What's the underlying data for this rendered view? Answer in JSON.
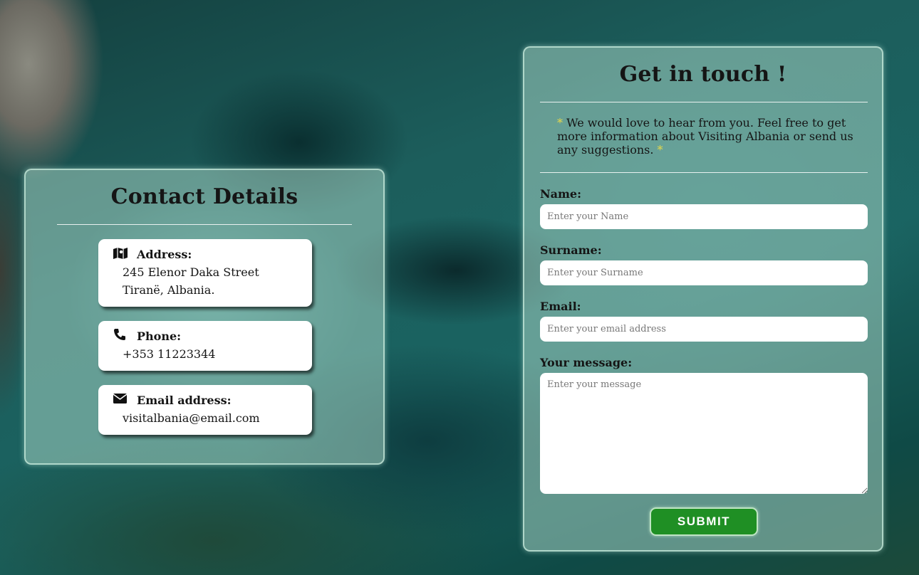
{
  "contact": {
    "title": "Contact Details",
    "cards": [
      {
        "icon": "map-icon",
        "label": "Address:",
        "lines": [
          "245 Elenor Daka Street",
          "Tiranë, Albania."
        ]
      },
      {
        "icon": "phone-icon",
        "label": "Phone:",
        "lines": [
          "+353 11223344"
        ]
      },
      {
        "icon": "envelope-icon",
        "label": "Email address:",
        "lines": [
          "visitalbania@email.com"
        ]
      }
    ]
  },
  "form": {
    "title": "Get in touch !",
    "intro_star": "*",
    "intro_text": " We would love to hear from you. Feel free to get more information about Visiting Albania or send us any suggestions. ",
    "fields": {
      "name": {
        "label": "Name:",
        "placeholder": "Enter your Name"
      },
      "surname": {
        "label": "Surname:",
        "placeholder": "Enter your Surname"
      },
      "email": {
        "label": "Email:",
        "placeholder": "Enter your email address"
      },
      "message": {
        "label": "Your message:",
        "placeholder": "Enter your message"
      }
    },
    "submit_label": "SUBMIT"
  },
  "colors": {
    "accent_star": "#e6d84a",
    "submit_bg": "#1f8f24"
  }
}
